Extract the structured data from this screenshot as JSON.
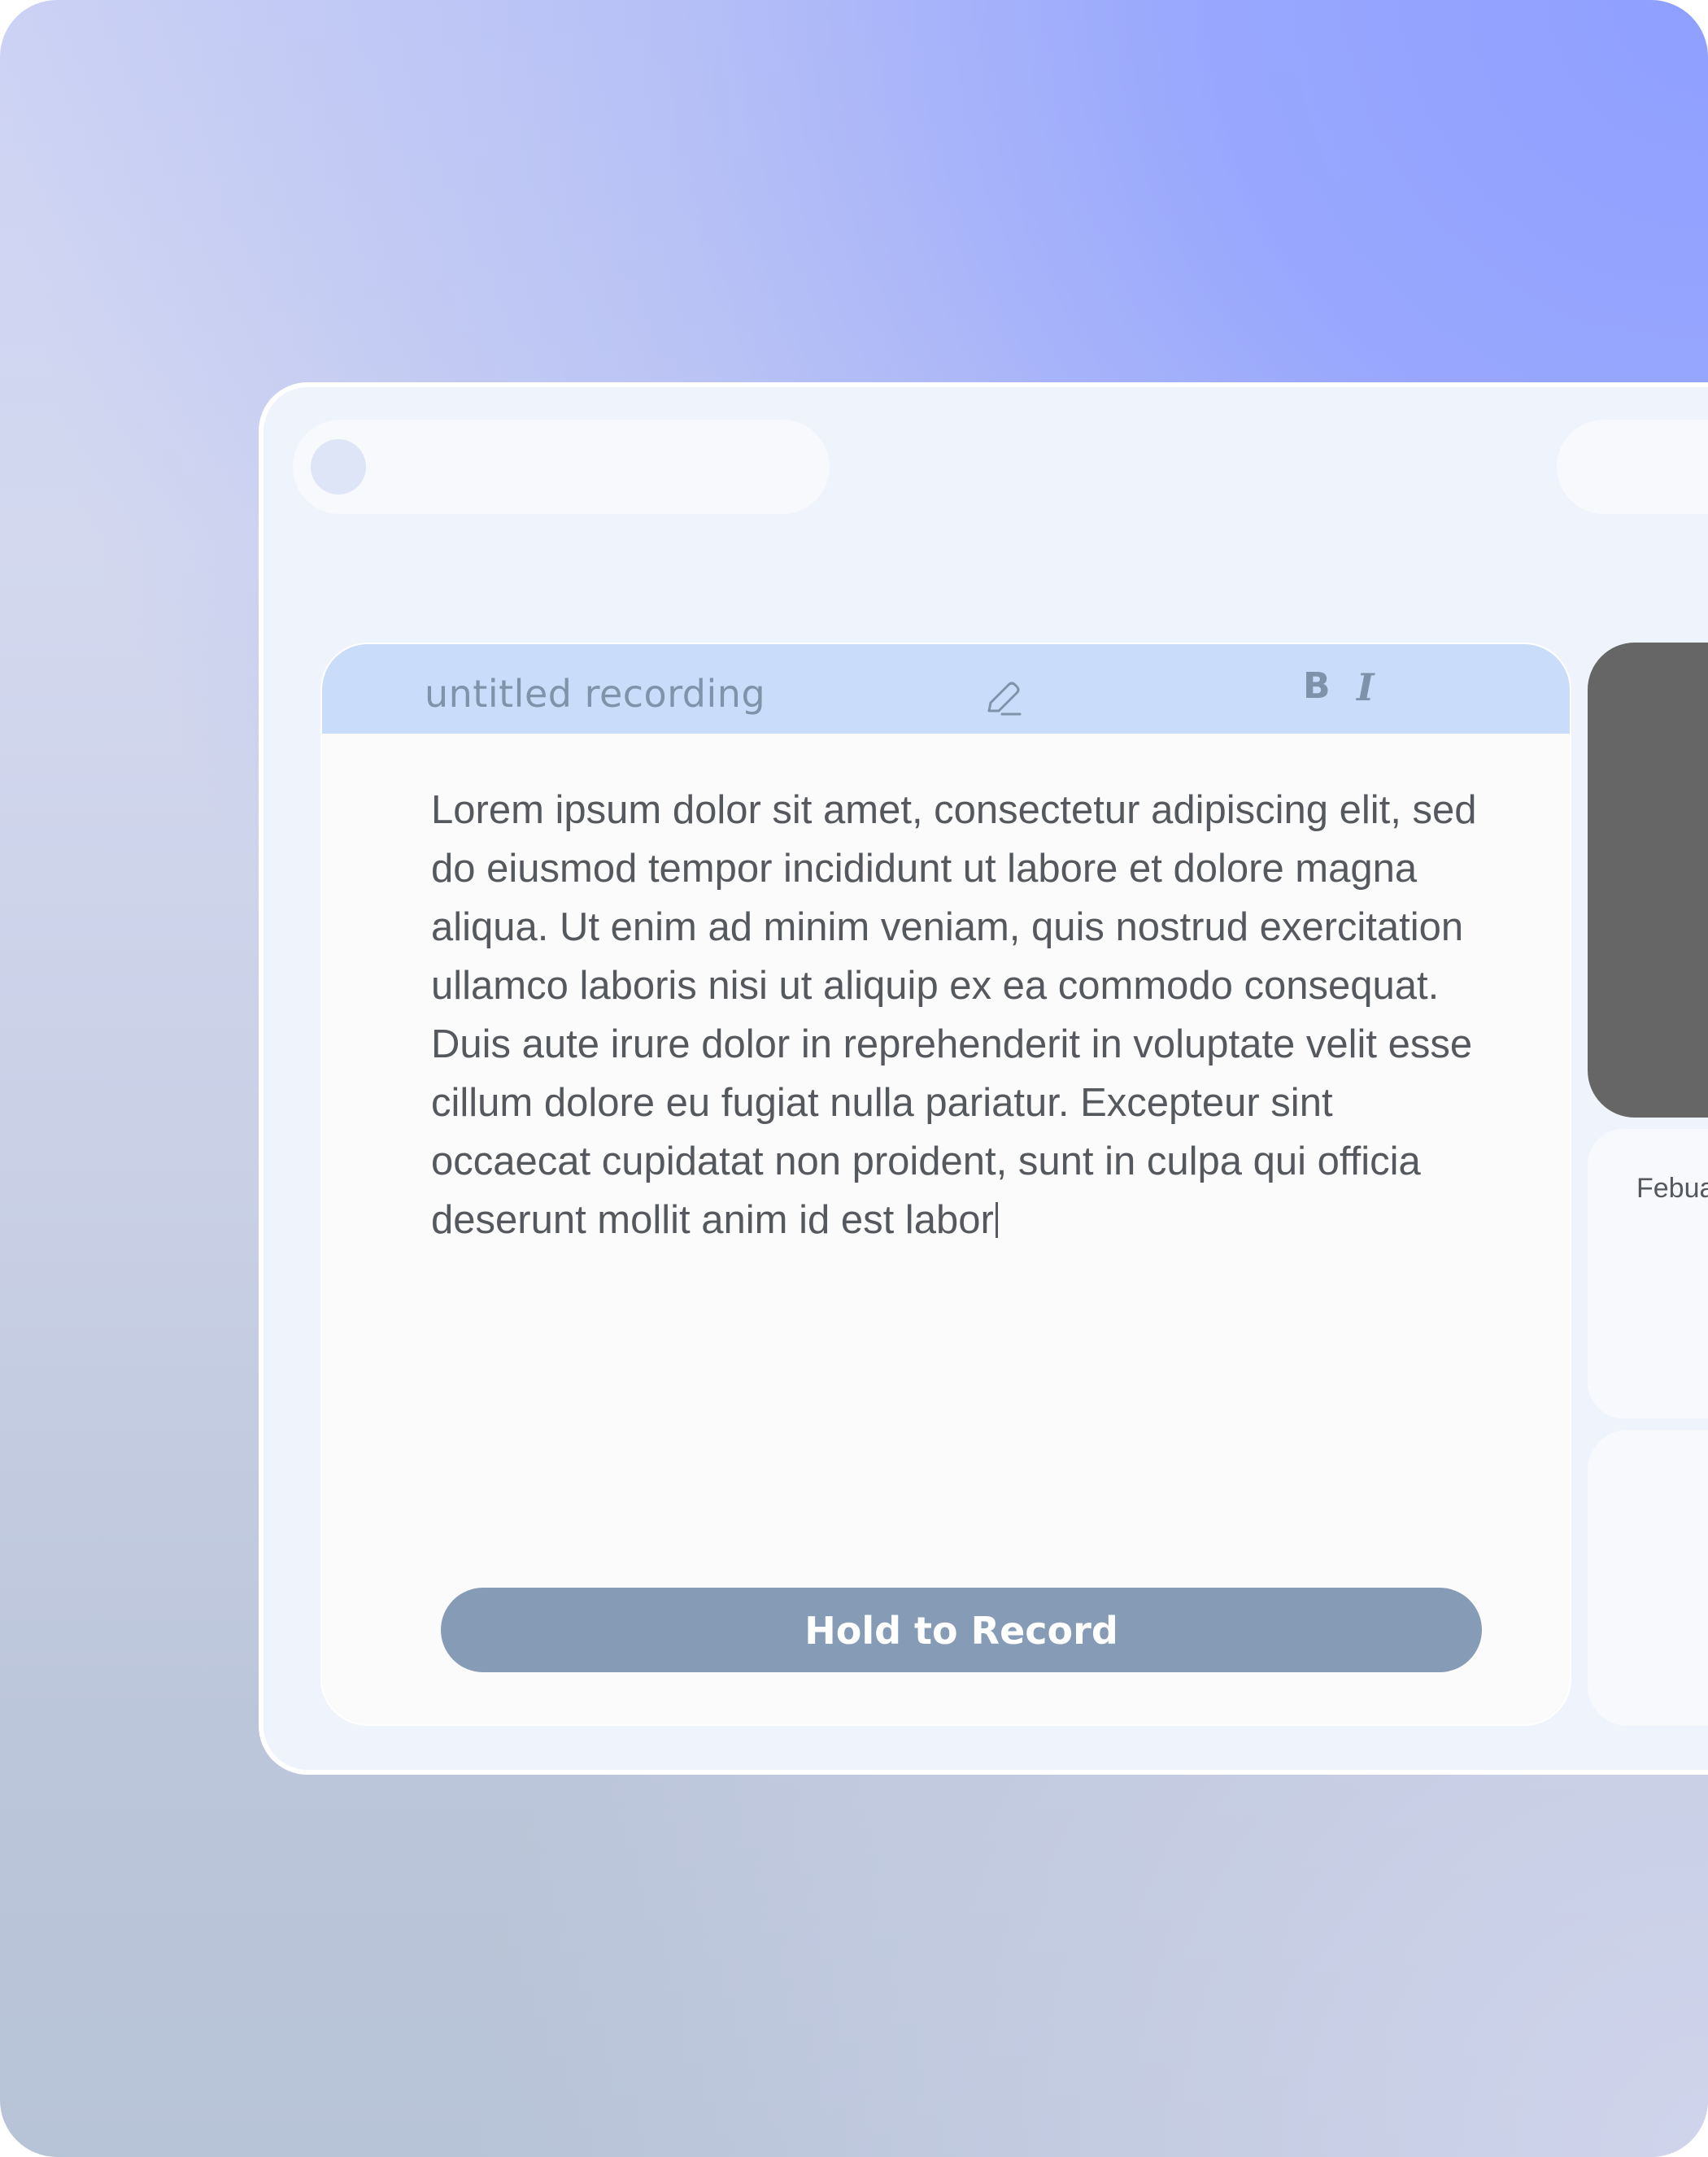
{
  "editor": {
    "title": "untitled recording",
    "format_bold": "B",
    "format_italic": "I",
    "body": "Lorem ipsum dolor sit amet, consectetur adipiscing elit, sed do eiusmod tempor incididunt ut labore et dolore magna aliqua. Ut enim ad minim veniam, quis nostrud exercitation ullamco laboris nisi ut aliquip ex ea commodo consequat. Duis aute irure dolor in reprehenderit in voluptate velit esse cillum dolore eu fugiat nulla pariatur. Excepteur sint occaecat cupidatat non proident, sunt in culpa qui officia deserunt mollit anim id est labor",
    "record_button": "Hold to Record",
    "edit_icon": "pencil-icon"
  },
  "side": {
    "date_partial": "Febua"
  },
  "colors": {
    "header": "#c9dcf9",
    "record_button": "#869bb5",
    "dark_card": "#666666",
    "accent_gradient": "#8f9fff"
  }
}
